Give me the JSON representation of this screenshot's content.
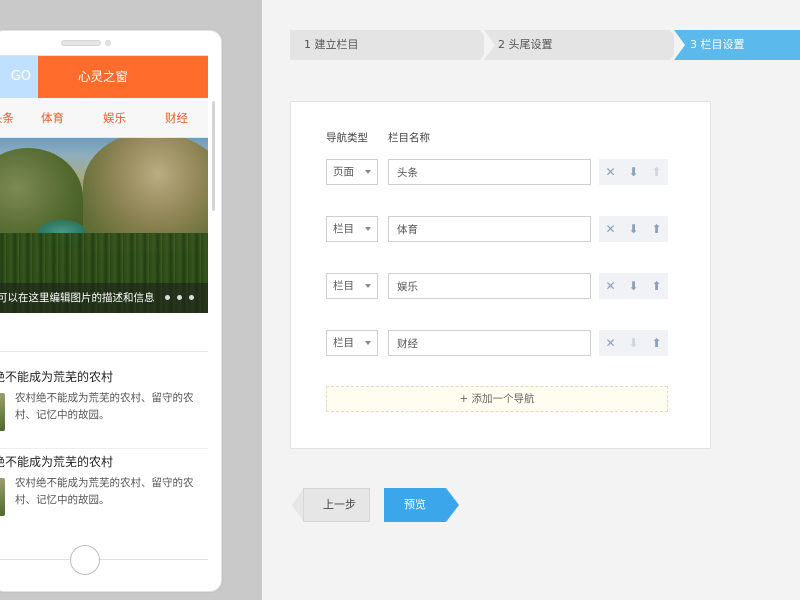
{
  "preview": {
    "logo_text": "GO",
    "site_title": "心灵之窗",
    "nav": [
      "头条",
      "体育",
      "娱乐",
      "财经"
    ],
    "hero_caption": "可以在这里编辑图片的描述和信息",
    "articles": [
      {
        "title": "绝不能成为荒芜的农村",
        "summary": "农村绝不能成为荒芜的农村、留守的农村、记忆中的故园。"
      },
      {
        "title": "绝不能成为荒芜的农村",
        "summary": "农村绝不能成为荒芜的农村、留守的农村、记忆中的故园。"
      }
    ]
  },
  "steps": [
    {
      "label": "1 建立栏目"
    },
    {
      "label": "2 头尾设置"
    },
    {
      "label": "3 栏目设置",
      "active": true
    }
  ],
  "form": {
    "col_type": "导航类型",
    "col_name": "栏目名称",
    "rows": [
      {
        "type": "页面",
        "name": "头条"
      },
      {
        "type": "栏目",
        "name": "体育"
      },
      {
        "type": "栏目",
        "name": "娱乐"
      },
      {
        "type": "栏目",
        "name": "财经"
      }
    ],
    "add_label": "+ 添加一个导航",
    "action_icons": {
      "delete": "✕",
      "down": "⬇",
      "up": "⬆"
    }
  },
  "buttons": {
    "prev": "上一步",
    "preview": "预览"
  },
  "colors": {
    "accent_blue": "#5bb9ec",
    "brand_orange": "#ff6c2b",
    "nav_text": "#f05a22"
  }
}
